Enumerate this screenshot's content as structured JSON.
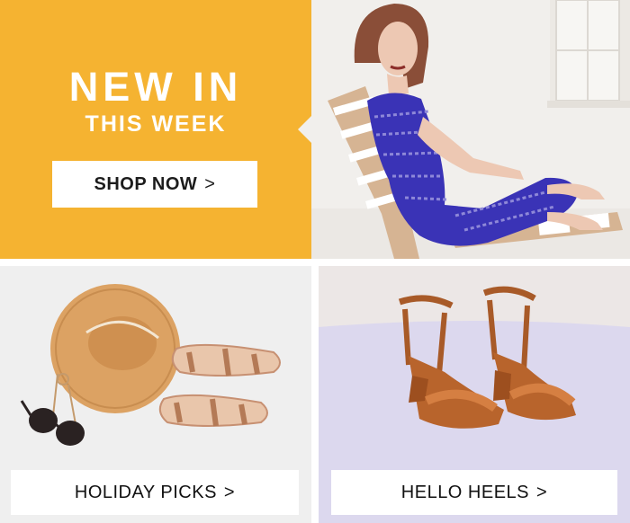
{
  "hero": {
    "title": "NEW IN",
    "subtitle": "THIS WEEK",
    "cta_label": "SHOP NOW",
    "cta_chevron": ">",
    "accent_color": "#f5b331"
  },
  "tiles": [
    {
      "label": "HOLIDAY PICKS",
      "chevron": ">",
      "background": "#efefef"
    },
    {
      "label": "HELLO HEELS",
      "chevron": ">",
      "background": "#e3e0ef"
    }
  ],
  "icons": {
    "chevron": "chevron-right-icon"
  }
}
